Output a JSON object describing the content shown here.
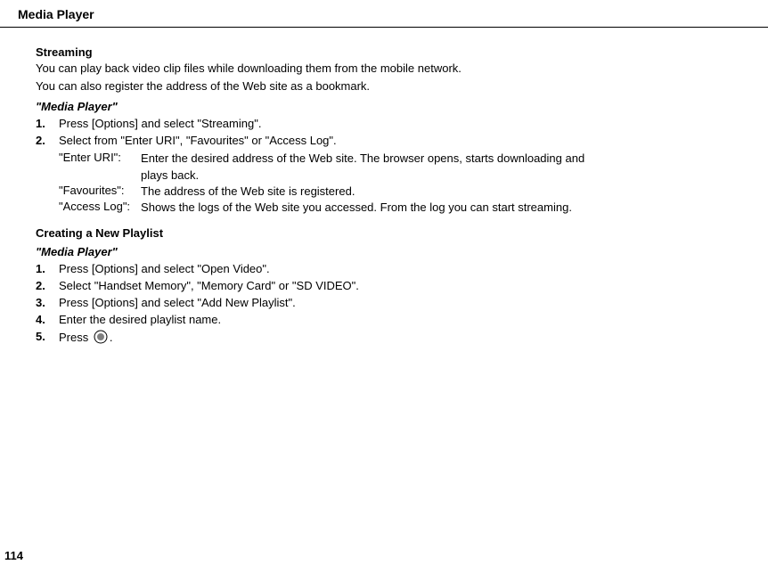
{
  "header": {
    "title": "Media Player"
  },
  "streaming": {
    "title": "Streaming",
    "para1": "You can play back video clip files while downloading them from the mobile network.",
    "para2": "You can also register the address of the Web site as a bookmark.",
    "label": "\"Media Player\"",
    "steps": [
      {
        "num": "1.",
        "text": "Press [Options] and select \"Streaming\"."
      },
      {
        "num": "2.",
        "text": "Select from \"Enter URI\", \"Favourites\" or \"Access Log\"."
      }
    ],
    "defs": [
      {
        "term": "\"Enter URI\":",
        "desc": "Enter the desired address of the Web site. The browser opens, starts downloading and plays back."
      },
      {
        "term": "\"Favourites\":",
        "desc": "The address of the Web site is registered."
      },
      {
        "term": "\"Access Log\":",
        "desc": "Shows the logs of the Web site you accessed. From the log you can start streaming."
      }
    ]
  },
  "playlist": {
    "title": "Creating a New Playlist",
    "label": "\"Media Player\"",
    "steps": [
      {
        "num": "1.",
        "text": "Press [Options] and select \"Open Video\"."
      },
      {
        "num": "2.",
        "text": "Select \"Handset Memory\", \"Memory Card\" or \"SD VIDEO\"."
      },
      {
        "num": "3.",
        "text": "Press [Options] and select \"Add New Playlist\"."
      },
      {
        "num": "4.",
        "text": "Enter the desired playlist name."
      },
      {
        "num": "5.",
        "prefix": "Press ",
        "suffix": "."
      }
    ]
  },
  "pageNumber": "114"
}
